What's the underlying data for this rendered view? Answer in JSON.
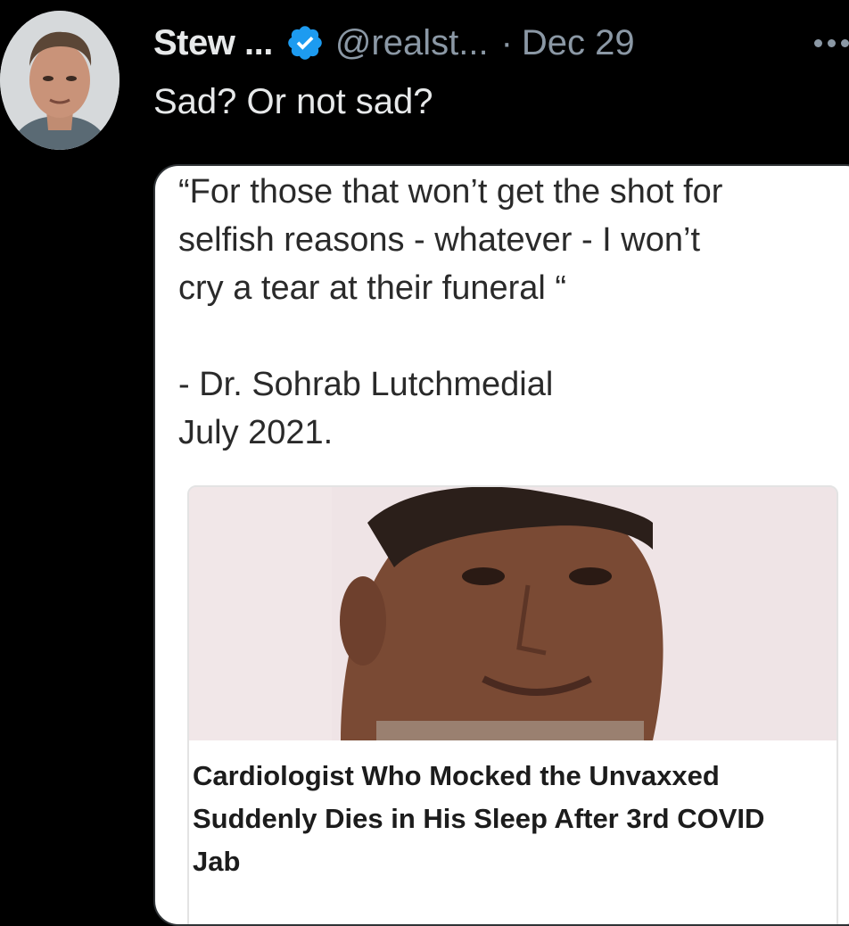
{
  "tweet": {
    "author_name": "Stew ...",
    "handle": "@realst...",
    "separator": "·",
    "date": "Dec 29",
    "text": "Sad? Or not sad?",
    "colors": {
      "background": "#000000",
      "text": "#e7e9ea",
      "secondary": "#8b98a5",
      "verified": "#1d9bf0"
    }
  },
  "media": {
    "quote_lines": [
      "“For those that won’t get the shot for",
      "selfish reasons - whatever - I won’t",
      "cry a tear at their funeral “",
      "- Dr. Sohrab Lutchmedial",
      "July 2021."
    ],
    "article": {
      "headline_lines": [
        "Cardiologist Who Mocked the Unvaxxed",
        "Suddenly Dies in His Sleep After 3rd COVID",
        "Jab"
      ]
    }
  }
}
